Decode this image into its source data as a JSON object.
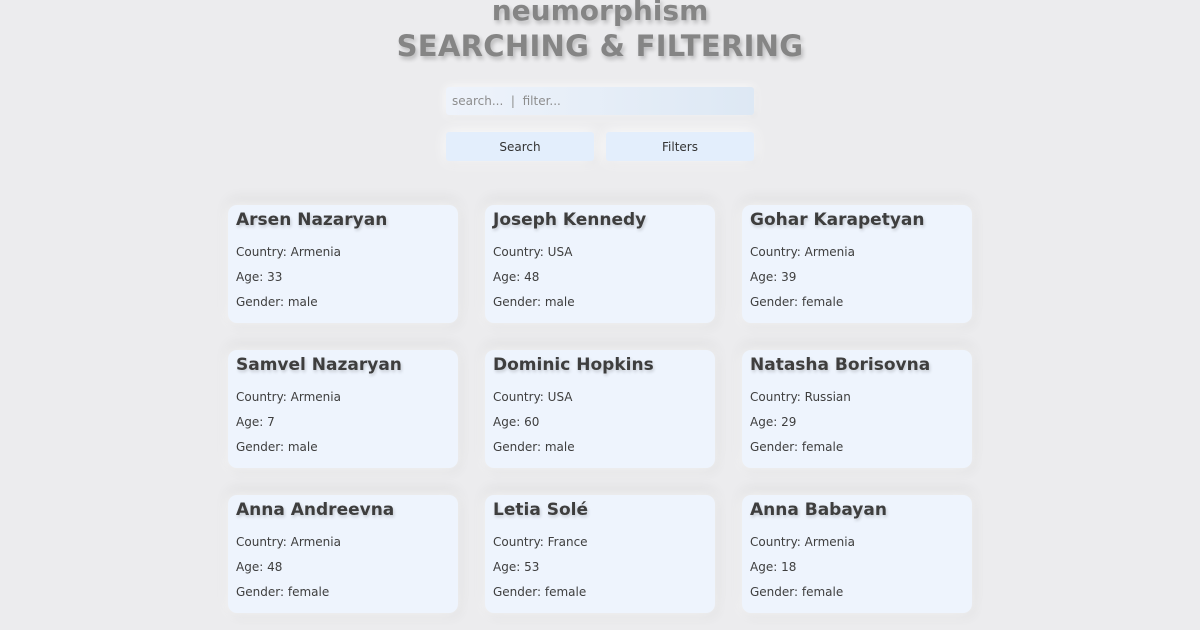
{
  "header": {
    "subtitle": "neumorphism",
    "title": "SEARCHING & FILTERING"
  },
  "search": {
    "placeholder": "search...  |  filter..."
  },
  "buttons": {
    "search_label": "Search",
    "filters_label": "Filters"
  },
  "field_labels": {
    "country": "Country",
    "age": "Age",
    "gender": "Gender"
  },
  "cards": [
    {
      "name": "Arsen Nazaryan",
      "country": "Country: Armenia",
      "age": "Age: 33",
      "gender": "Gender: male"
    },
    {
      "name": "Joseph Kennedy",
      "country": "Country: USA",
      "age": "Age: 48",
      "gender": "Gender: male"
    },
    {
      "name": "Gohar Karapetyan",
      "country": "Country: Armenia",
      "age": "Age: 39",
      "gender": "Gender: female"
    },
    {
      "name": "Samvel Nazaryan",
      "country": "Country: Armenia",
      "age": "Age: 7",
      "gender": "Gender: male"
    },
    {
      "name": "Dominic Hopkins",
      "country": "Country: USA",
      "age": "Age: 60",
      "gender": "Gender: male"
    },
    {
      "name": "Natasha Borisovna",
      "country": "Country: Russian",
      "age": "Age: 29",
      "gender": "Gender: female"
    },
    {
      "name": "Anna Andreevna",
      "country": "Country: Armenia",
      "age": "Age: 48",
      "gender": "Gender: female"
    },
    {
      "name": "Letia Solé",
      "country": "Country: France",
      "age": "Age: 53",
      "gender": "Gender: female"
    },
    {
      "name": "Anna Babayan",
      "country": "Country: Armenia",
      "age": "Age: 18",
      "gender": "Gender: female"
    }
  ],
  "colors": {
    "background": "#ececee",
    "card": "#eef4fd",
    "button": "#e3eefc",
    "heading": "#858585"
  }
}
